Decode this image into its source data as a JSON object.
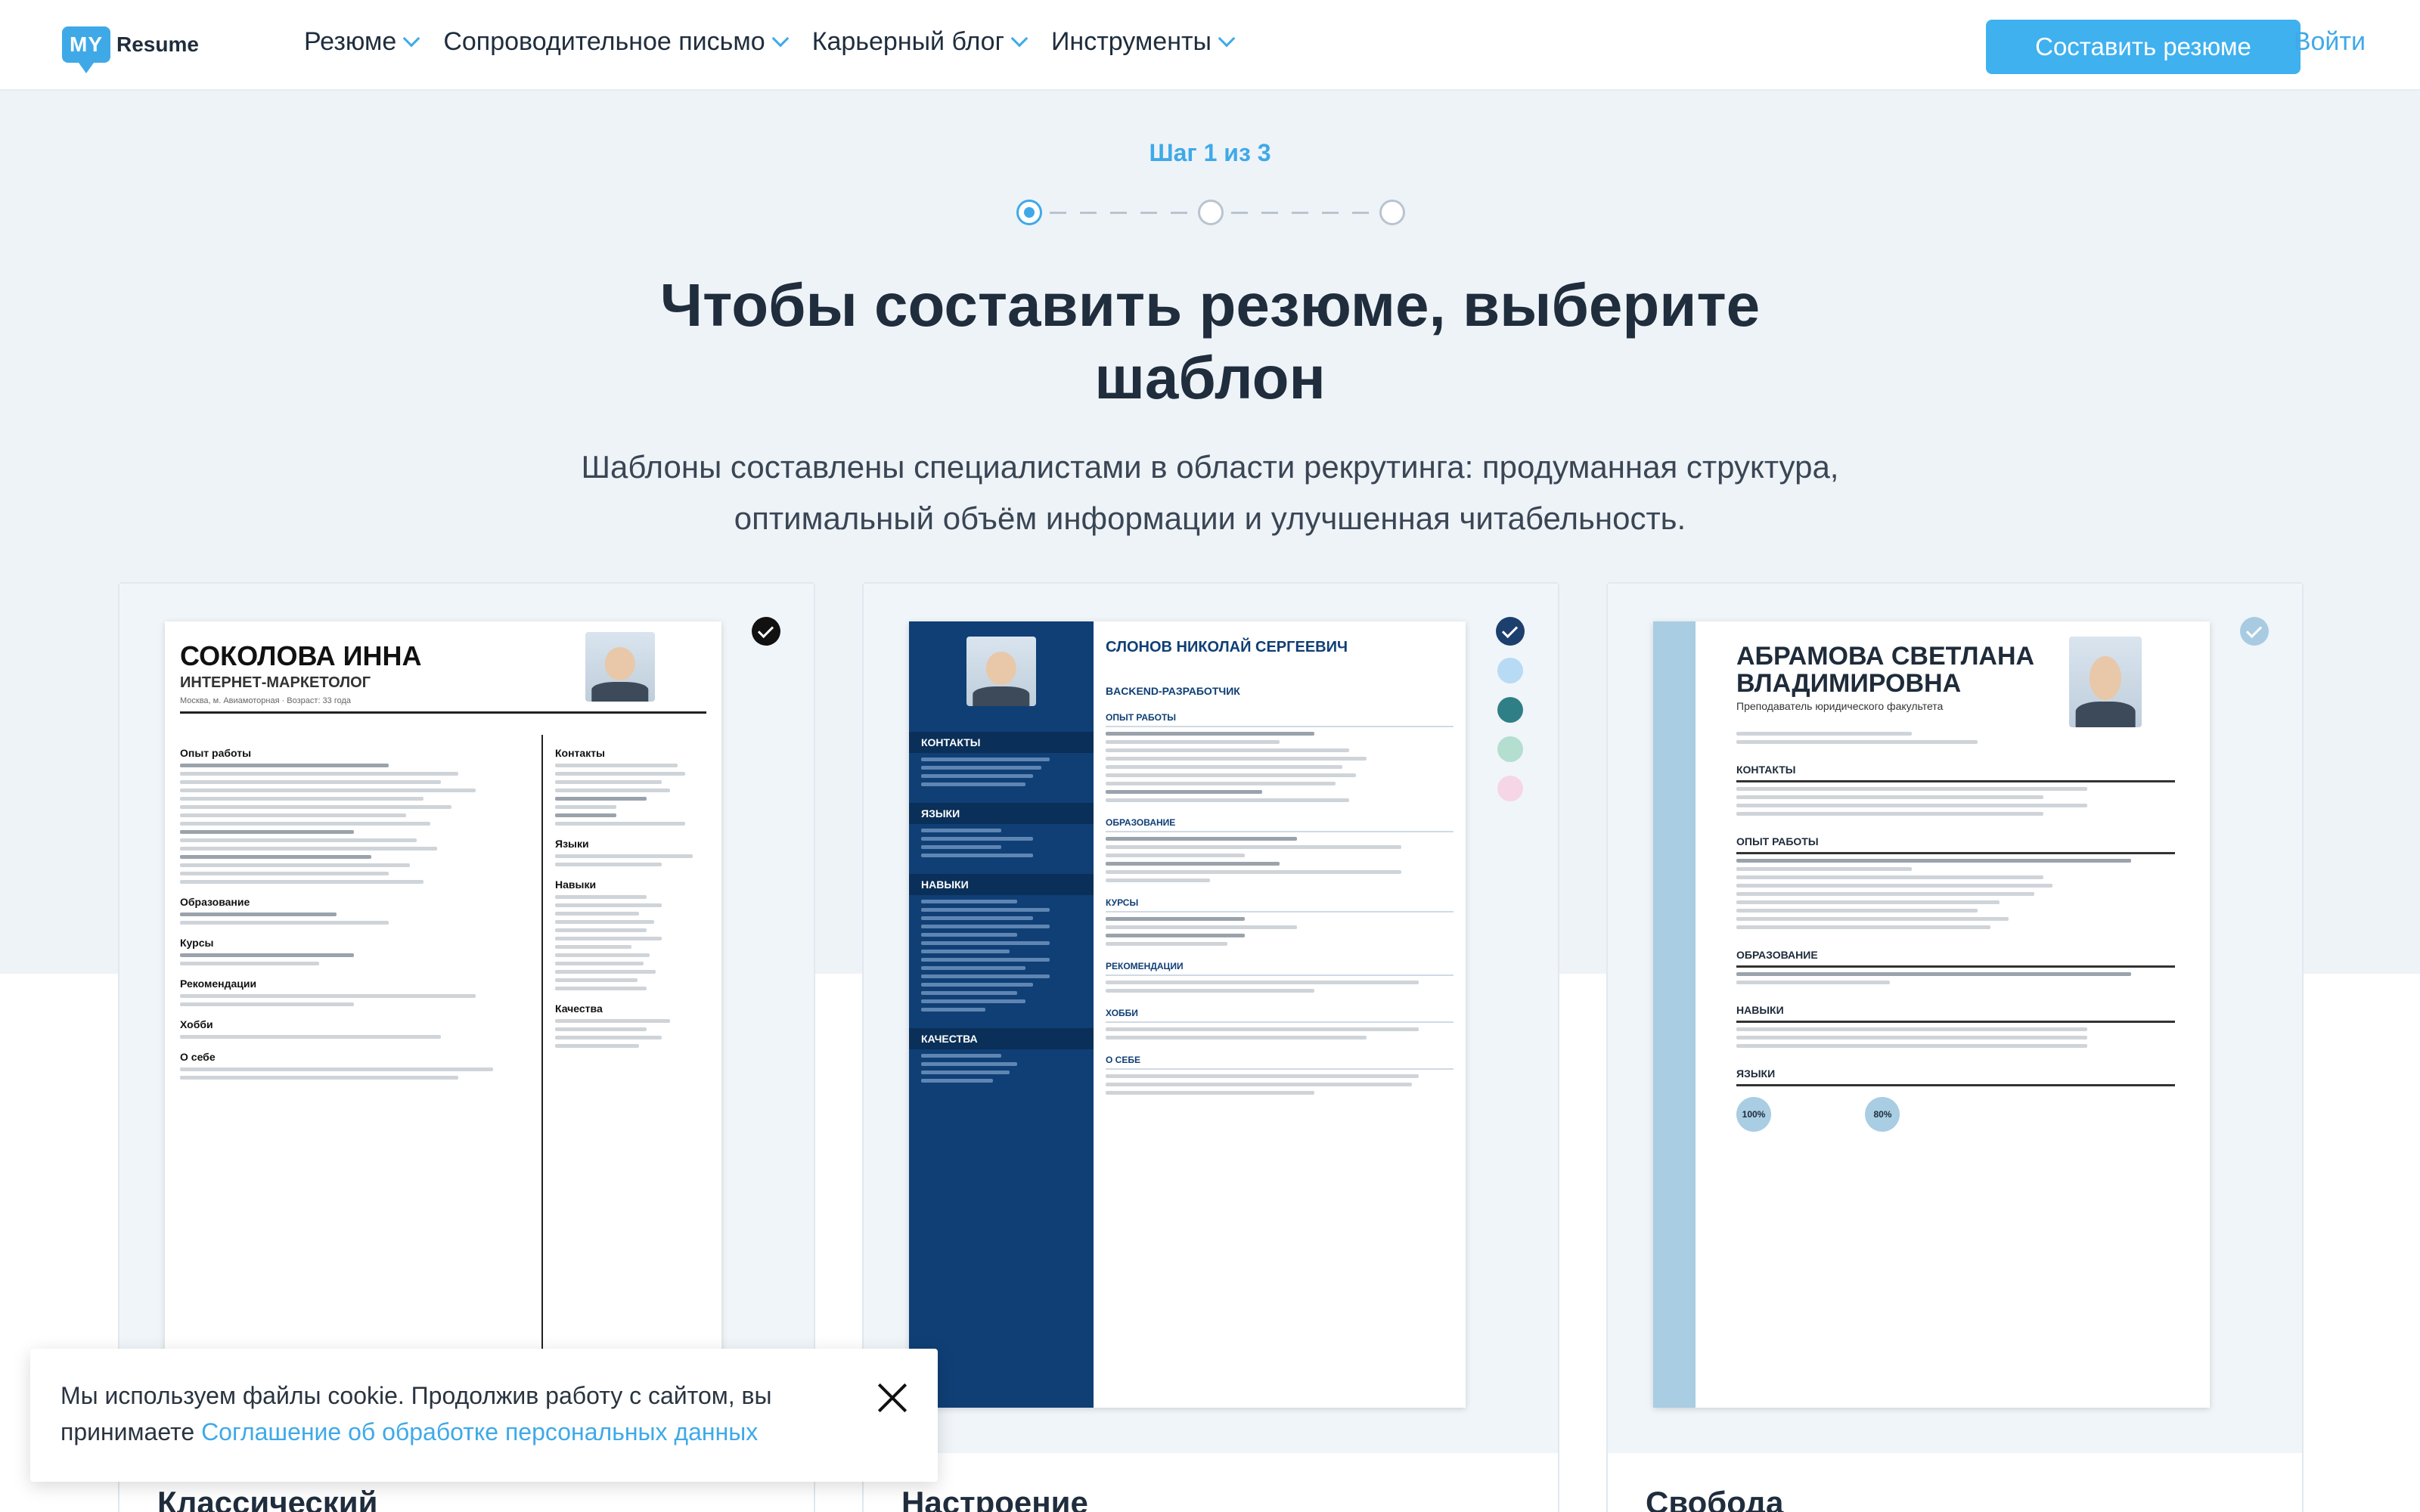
{
  "header": {
    "logo_my": "MY",
    "logo_resume": "Resume",
    "nav": [
      {
        "label": "Резюме"
      },
      {
        "label": "Сопроводительное письмо"
      },
      {
        "label": "Карьерный блог"
      },
      {
        "label": "Инструменты"
      }
    ],
    "create_button": "Составить резюме",
    "login": "Войти"
  },
  "wizard": {
    "step_text": "Шаг 1 из 3",
    "current_step": 1,
    "total_steps": 3
  },
  "hero": {
    "title_line1": "Чтобы составить резюме, выберите",
    "title_line2": "шаблон",
    "subtitle_line1": "Шаблоны составлены специалистами в области рекрутинга: продуманная структура,",
    "subtitle_line2": "оптимальный объём информации и улучшенная читабельность."
  },
  "templates": [
    {
      "title": "Классический",
      "name": "СОКОЛОВА ИННА",
      "role": "ИНТЕРНЕТ-МАРКЕТОЛОГ",
      "meta": "Москва, м. Авиамоторная · Возраст: 33 года",
      "sections_left": [
        "Опыт работы",
        "Образование",
        "Курсы",
        "Рекомендации",
        "Хобби",
        "О себе"
      ],
      "sections_right": [
        "Контакты",
        "Языки",
        "Навыки",
        "Качества"
      ],
      "check_color": "#111111"
    },
    {
      "title": "Настроение",
      "name": "СЛОНОВ НИКОЛАЙ СЕРГЕЕВИЧ",
      "role": "BACKEND-РАЗРАБОТЧИК",
      "sidebar_sections": [
        "КОНТАКТЫ",
        "ЯЗЫКИ",
        "НАВЫКИ",
        "КАЧЕСТВА"
      ],
      "main_sections": [
        "ОПЫТ РАБОТЫ",
        "ОБРАЗОВАНИЕ",
        "КУРСЫ",
        "РЕКОМЕНДАЦИИ",
        "ХОББИ",
        "О СЕБЕ"
      ],
      "check_color": "#1d3f6e",
      "swatches": [
        "#b7daf5",
        "#2f7f86",
        "#b3ded0",
        "#f6d6e6"
      ]
    },
    {
      "title": "Свобода",
      "name_line1": "АБРАМОВА СВЕТЛАНА",
      "name_line2": "ВЛАДИМИРОВНА",
      "role": "Преподаватель юридического факультета",
      "sections": [
        "КОНТАКТЫ",
        "ОПЫТ РАБОТЫ",
        "ОБРАЗОВАНИЕ",
        "НАВЫКИ",
        "ЯЗЫКИ"
      ],
      "languages": [
        {
          "level": "100%"
        },
        {
          "level": "80%"
        }
      ],
      "check_color": "#a8cbe2"
    }
  ],
  "cookie": {
    "text": "Мы используем файлы cookie. Продолжив работу с сайтом, вы принимаете ",
    "link": "Соглашение об обработке персональных данных"
  },
  "colors": {
    "accent": "#3fa9e8",
    "hero_bg": "#eef3f8",
    "text": "#1f2d3d"
  }
}
